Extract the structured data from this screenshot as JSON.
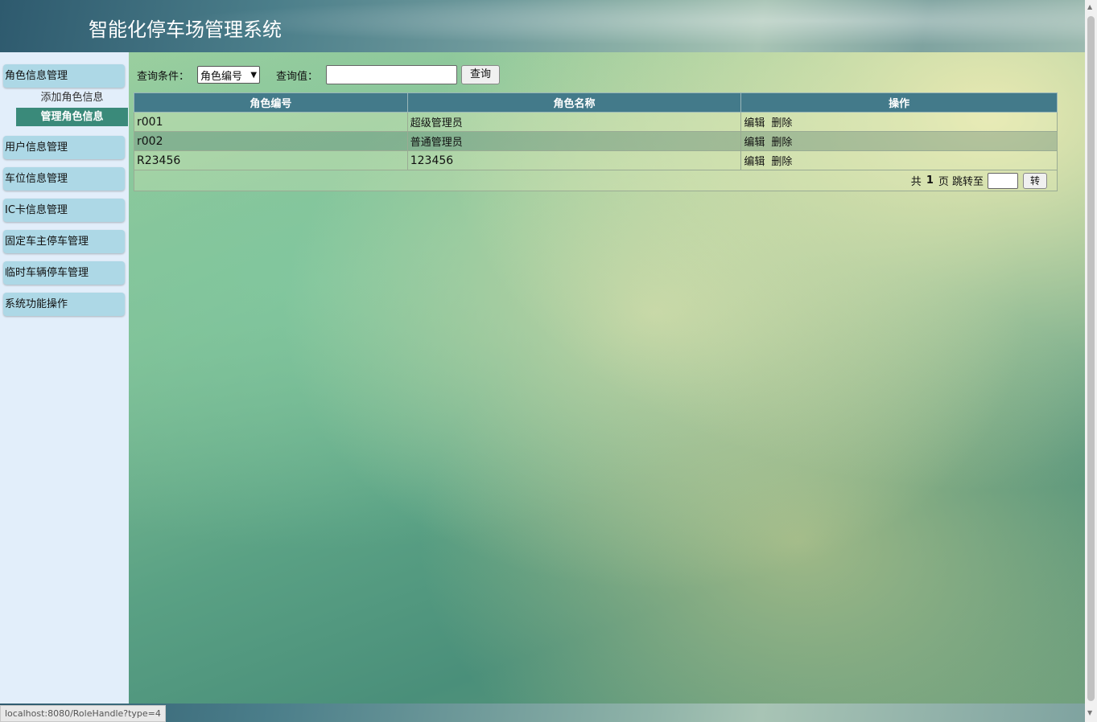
{
  "header": {
    "title": "智能化停车场管理系统"
  },
  "sidebar": {
    "menus": [
      {
        "label": "角色信息管理",
        "subs": [
          {
            "label": "添加角色信息",
            "active": false
          },
          {
            "label": "管理角色信息",
            "active": true
          }
        ]
      },
      {
        "label": "用户信息管理"
      },
      {
        "label": "车位信息管理"
      },
      {
        "label": "IC卡信息管理"
      },
      {
        "label": "固定车主停车管理"
      },
      {
        "label": "临时车辆停车管理"
      },
      {
        "label": "系统功能操作"
      }
    ]
  },
  "search": {
    "condition_label": "查询条件：",
    "condition_value": "角色编号",
    "value_label": "查询值：",
    "value": "",
    "button": "查询"
  },
  "table": {
    "headers": [
      "角色编号",
      "角色名称",
      "操作"
    ],
    "rows": [
      {
        "id": "r001",
        "name": "超级管理员",
        "edit": "编辑",
        "delete": "删除"
      },
      {
        "id": "r002",
        "name": "普通管理员",
        "edit": "编辑",
        "delete": "删除"
      },
      {
        "id": "R23456",
        "name": "123456",
        "edit": "编辑",
        "delete": "删除"
      }
    ]
  },
  "pager": {
    "prefix": "共",
    "total": "1",
    "suffix": "页 跳转至",
    "button": "转"
  },
  "statusbar": {
    "url": "localhost:8080/RoleHandle?type=4"
  },
  "colors": {
    "table_header": "#437a8a",
    "sidebar_bg": "#e2eefa",
    "menu_bg": "#add8e6",
    "active_sub": "#3a8a7a"
  }
}
